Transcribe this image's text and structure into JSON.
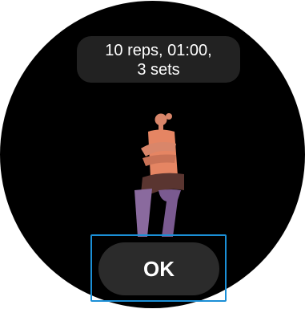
{
  "workout": {
    "summary_line1": "10 reps, 01:00,",
    "summary_line2": "3 sets"
  },
  "actions": {
    "ok_label": "OK"
  },
  "colors": {
    "background": "#000000",
    "pill": "#222222",
    "button": "#2b2b2b",
    "focus_outline": "#1b8fd6",
    "figure_skin": "#d9866a",
    "figure_shirt": "#e58563",
    "figure_shorts": "#5a3530",
    "figure_legs": "#8a6a9e"
  }
}
